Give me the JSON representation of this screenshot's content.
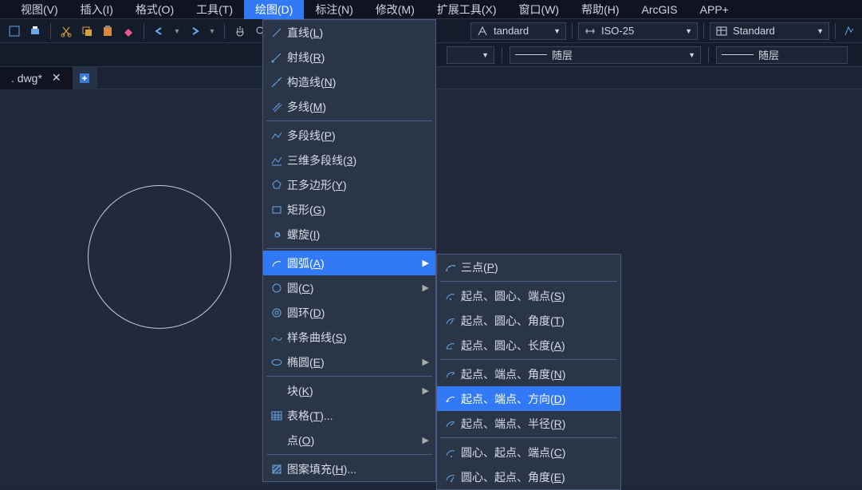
{
  "menubar": [
    {
      "label": "视图(V)"
    },
    {
      "label": "插入(I)"
    },
    {
      "label": "格式(O)"
    },
    {
      "label": "工具(T)"
    },
    {
      "label": "绘图(D)",
      "active": true
    },
    {
      "label": "标注(N)"
    },
    {
      "label": "修改(M)"
    },
    {
      "label": "扩展工具(X)"
    },
    {
      "label": "窗口(W)"
    },
    {
      "label": "帮助(H)"
    },
    {
      "label": "ArcGIS"
    },
    {
      "label": "APP+"
    }
  ],
  "toolbar_right": {
    "style_dd1": "tandard",
    "style_dd2": "ISO-25",
    "style_dd3": "Standard"
  },
  "secondbar": {
    "layer1": "随层",
    "layer2": "随层"
  },
  "tab": {
    "name": ". dwg*"
  },
  "draw_menu": {
    "items": [
      {
        "icon": "line",
        "label": "直线(",
        "u": "L",
        "after": ")"
      },
      {
        "icon": "ray",
        "label": "射线(",
        "u": "R",
        "after": ")"
      },
      {
        "icon": "conline",
        "label": "构造线(",
        "u": "N",
        "after": ")"
      },
      {
        "icon": "multiline",
        "label": "多线(",
        "u": "M",
        "after": ")"
      },
      "sep",
      {
        "icon": "polyline",
        "label": "多段线(",
        "u": "P",
        "after": ")"
      },
      {
        "icon": "3dpoly",
        "label": "三维多段线(",
        "u": "3",
        "after": ")"
      },
      {
        "icon": "polygon",
        "label": "正多边形(",
        "u": "Y",
        "after": ")"
      },
      {
        "icon": "rect",
        "label": "矩形(",
        "u": "G",
        "after": ")"
      },
      {
        "icon": "spiral",
        "label": "螺旋(",
        "u": "I",
        "after": ")"
      },
      "sep",
      {
        "icon": "arc",
        "label": "圆弧(",
        "u": "A",
        "after": ")",
        "submenu": true,
        "highlight": true
      },
      {
        "icon": "circle",
        "label": "圆(",
        "u": "C",
        "after": ")",
        "submenu": true
      },
      {
        "icon": "donut",
        "label": "圆环(",
        "u": "D",
        "after": ")"
      },
      {
        "icon": "spline",
        "label": "样条曲线(",
        "u": "S",
        "after": ")"
      },
      {
        "icon": "ellipse",
        "label": "椭圆(",
        "u": "E",
        "after": ")",
        "submenu": true
      },
      "sep",
      {
        "icon": "block",
        "label": "块(",
        "u": "K",
        "after": ")",
        "submenu": true
      },
      {
        "icon": "table",
        "label": "表格(",
        "u": "T",
        "after": ")..."
      },
      {
        "icon": "point",
        "label": "点(",
        "u": "O",
        "after": ")",
        "submenu": true
      },
      "sep",
      {
        "icon": "hatch",
        "label": "图案填充(",
        "u": "H",
        "after": ")..."
      }
    ]
  },
  "arc_submenu": {
    "items": [
      {
        "icon": "arc3p",
        "label": "三点(",
        "u": "P",
        "after": ")"
      },
      "sep",
      {
        "icon": "arc_sce",
        "label": "起点、圆心、端点(",
        "u": "S",
        "after": ")"
      },
      {
        "icon": "arc_sca",
        "label": "起点、圆心、角度(",
        "u": "T",
        "after": ")"
      },
      {
        "icon": "arc_scl",
        "label": "起点、圆心、长度(",
        "u": "A",
        "after": ")"
      },
      "sep",
      {
        "icon": "arc_sea",
        "label": "起点、端点、角度(",
        "u": "N",
        "after": ")"
      },
      {
        "icon": "arc_sed",
        "label": "起点、端点、方向(",
        "u": "D",
        "after": ")",
        "highlight": true
      },
      {
        "icon": "arc_ser",
        "label": "起点、端点、半径(",
        "u": "R",
        "after": ")"
      },
      "sep",
      {
        "icon": "arc_cse",
        "label": "圆心、起点、端点(",
        "u": "C",
        "after": ")"
      },
      {
        "icon": "arc_csa",
        "label": "圆心、起点、角度(",
        "u": "E",
        "after": ")"
      }
    ]
  }
}
